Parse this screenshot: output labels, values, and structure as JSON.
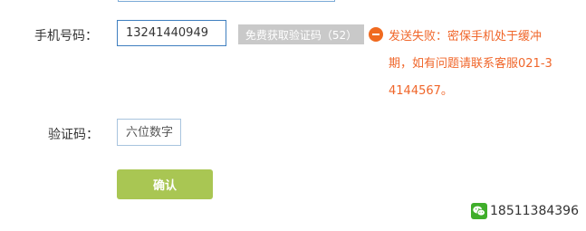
{
  "form": {
    "phone_label": "手机号码：",
    "phone_value": "13241440949",
    "get_code_label": "免费获取验证码（52）",
    "error_text": "发送失败：密保手机处于缓冲期，如有问题请联系客服021-34144567。",
    "code_label": "验证码：",
    "code_placeholder": "六位数字",
    "confirm_label": "确认"
  },
  "contact": {
    "icon": "wechat-icon",
    "phone": "18511384396"
  },
  "colors": {
    "error": "#f0662a",
    "confirm_button": "#a9c653",
    "disabled_button": "#c9c9c9",
    "input_border": "#3f7fbf"
  }
}
